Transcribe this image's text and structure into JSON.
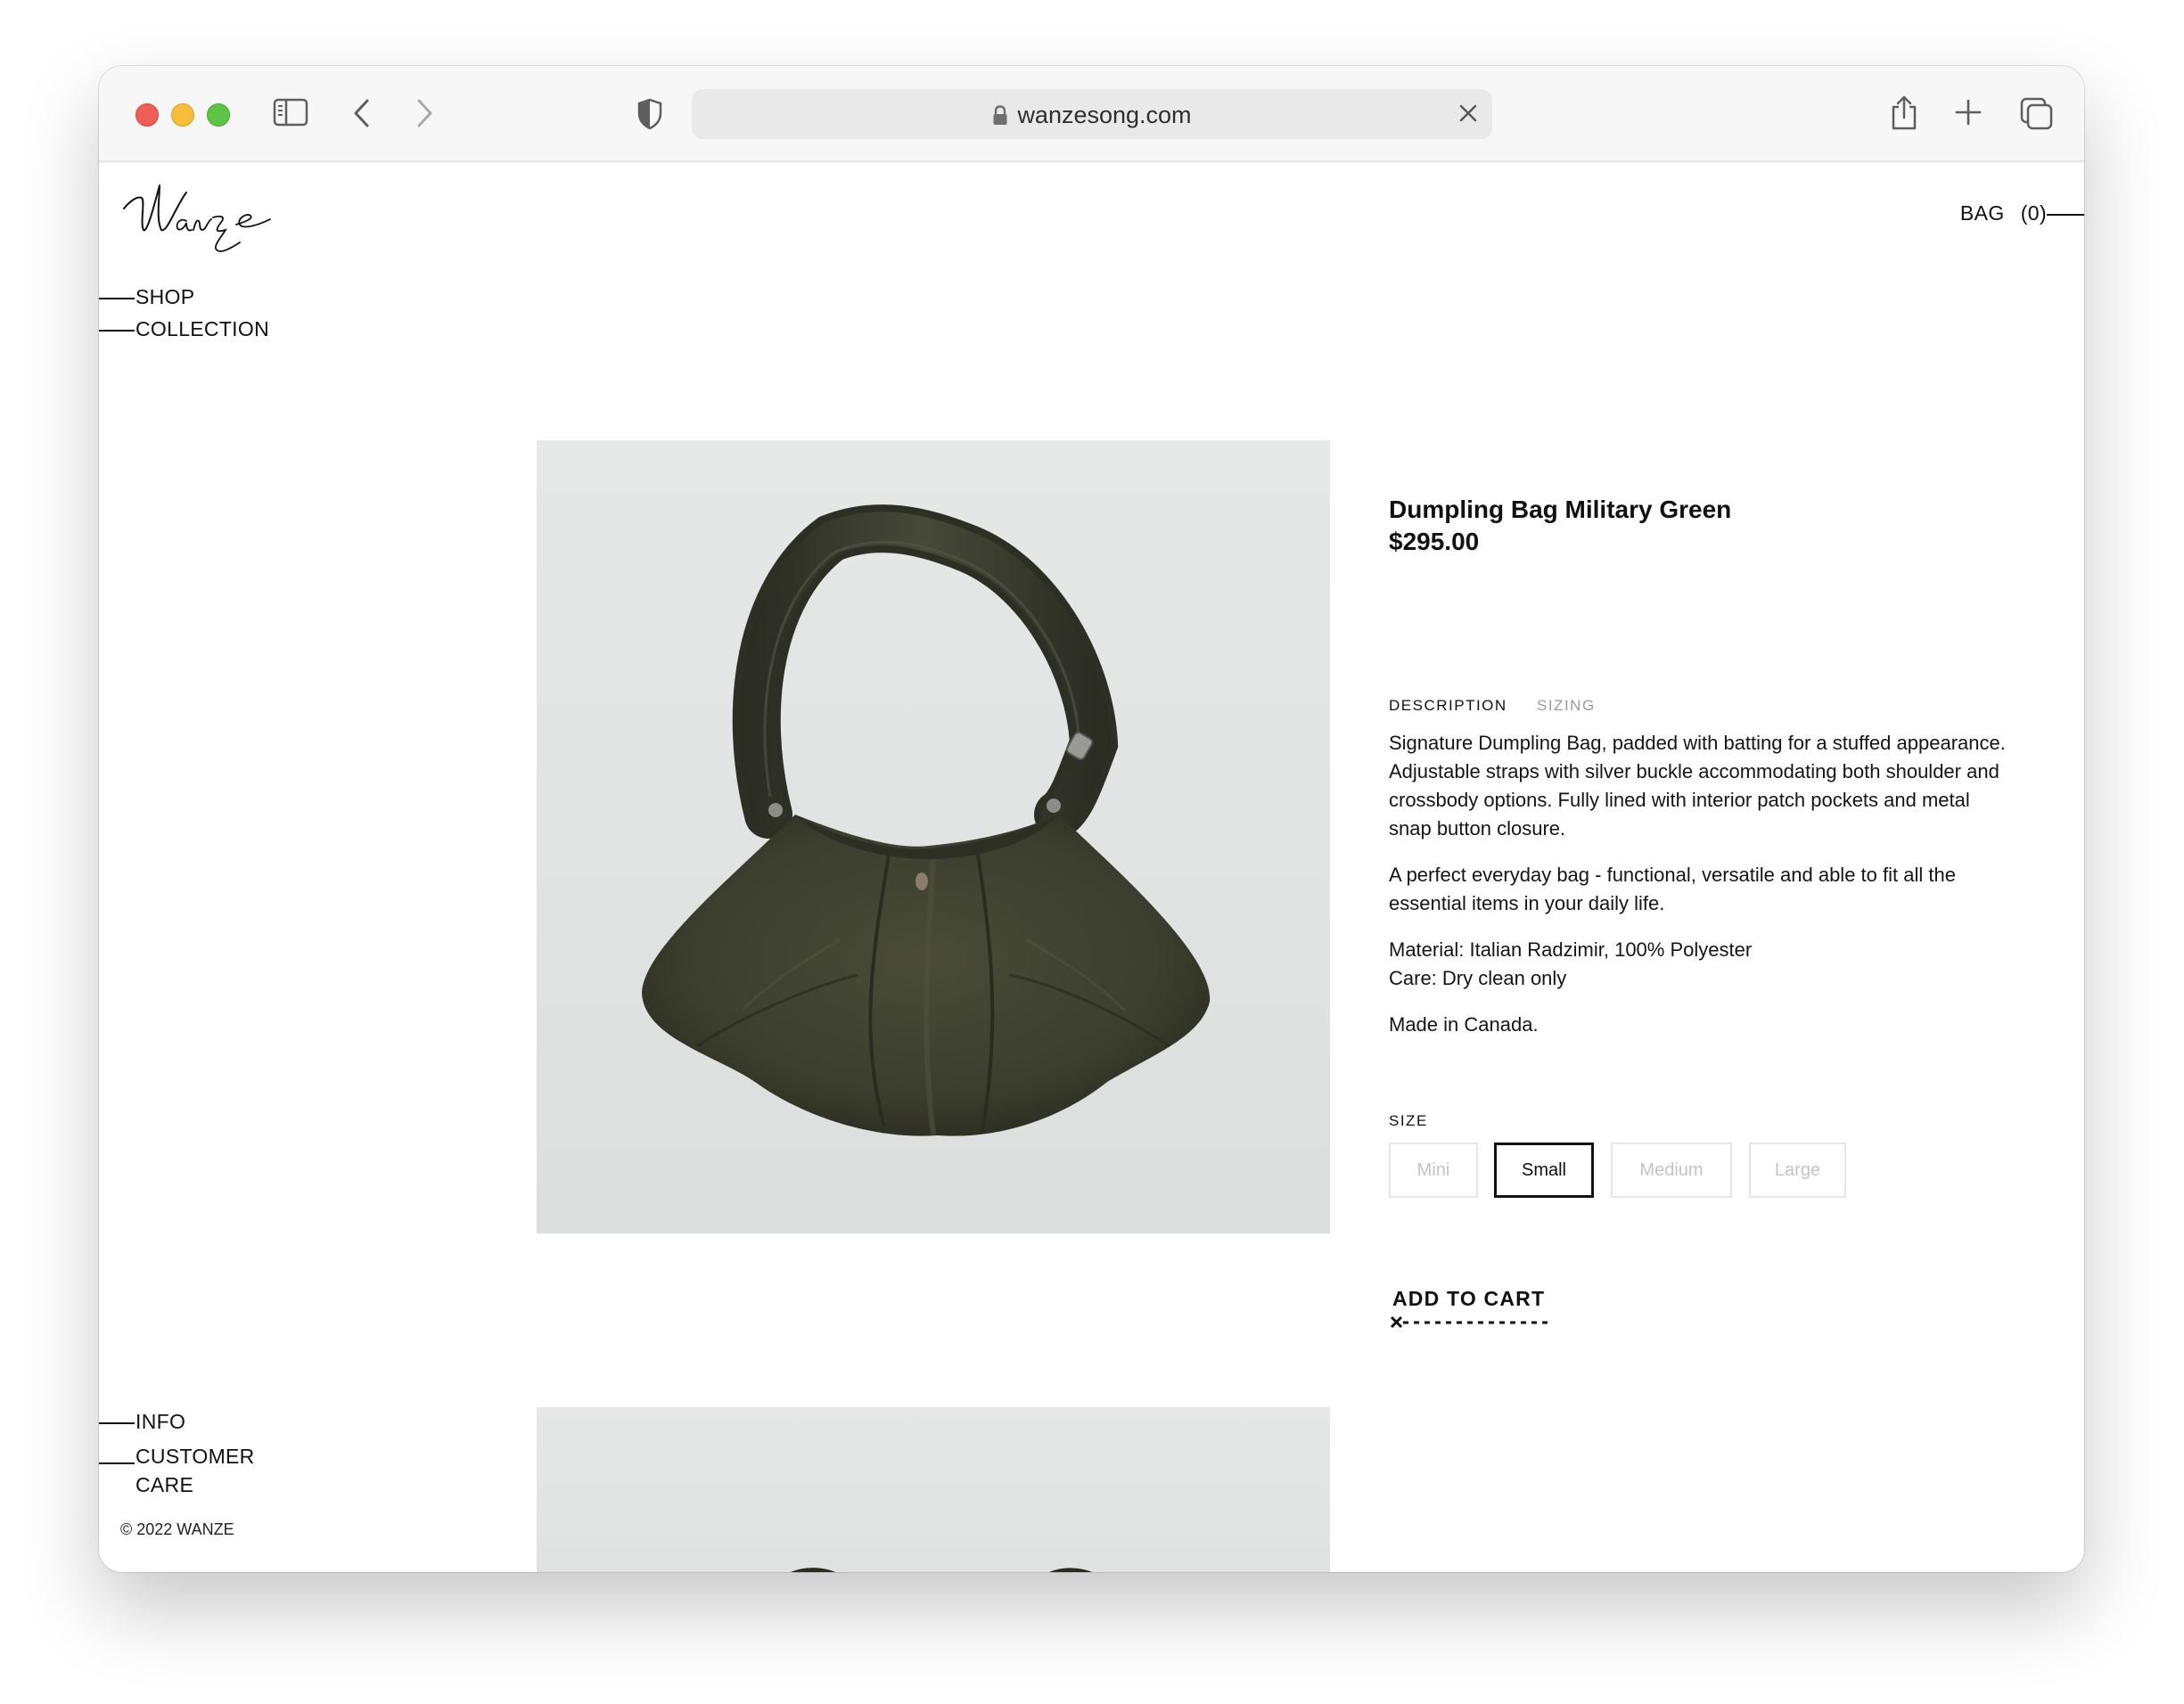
{
  "browser": {
    "url": "wanzesong.com"
  },
  "site": {
    "logo_text": "Wanze",
    "nav_top": [
      {
        "label": "SHOP"
      },
      {
        "label": "COLLECTION"
      }
    ],
    "nav_bottom": {
      "info": "INFO",
      "customer_care_line1": "CUSTOMER",
      "customer_care_line2": "CARE"
    },
    "bag_label": "BAG",
    "bag_count": "(0)",
    "copyright": "© 2022 WANZE"
  },
  "product": {
    "title": "Dumpling Bag Military Green",
    "price": "$295.00",
    "tabs": [
      {
        "label": "DESCRIPTION",
        "active": true
      },
      {
        "label": "SIZING",
        "active": false
      }
    ],
    "description": [
      "Signature Dumpling Bag, padded with batting for a stuffed appearance. Adjustable straps with silver buckle accommodating both shoulder and crossbody options. Fully lined with interior patch pockets and metal snap button closure.",
      "A perfect everyday bag - functional, versatile and able to fit all the essential items in your daily life.",
      "Material: Italian Radzimir, 100% Polyester",
      "Care: Dry clean only",
      "Made in Canada."
    ],
    "size_label": "SIZE",
    "sizes": [
      {
        "label": "Mini",
        "selected": false
      },
      {
        "label": "Small",
        "selected": true
      },
      {
        "label": "Medium",
        "selected": false
      },
      {
        "label": "Large",
        "selected": false
      }
    ],
    "add_to_cart": "ADD TO CART"
  },
  "colors": {
    "bag_green": "#3b3d2e",
    "image_bg": "#e4e6e6",
    "text": "#111111"
  }
}
